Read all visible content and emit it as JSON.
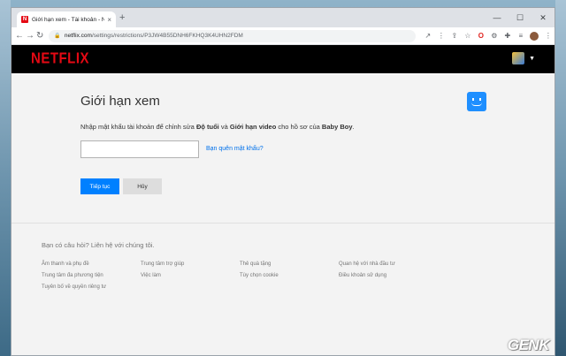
{
  "browser": {
    "tab_title": "Giới hạn xem - Tài khoản - Netflix",
    "tab_close": "×",
    "new_tab": "+",
    "window_controls": {
      "minimize": "—",
      "maximize": "☐",
      "close": "✕"
    },
    "nav": {
      "back": "←",
      "forward": "→",
      "reload": "↻"
    },
    "url_host": "netflix.com",
    "url_path": "/settings/restrictions/P3JW4B55DNH6FKHQ3K4UHN2FDM",
    "toolbar_icons": [
      "↗",
      "⋮",
      "⇪",
      "☆"
    ],
    "menu": "⋮"
  },
  "netflix": {
    "logo": "NETFLIX",
    "profile_caret": "▼"
  },
  "main": {
    "title": "Giới hạn xem",
    "desc_prefix": "Nhập mật khẩu tài khoản để chỉnh sửa ",
    "desc_b1": "Độ tuổi",
    "desc_mid": " và ",
    "desc_b2": "Giới hạn video",
    "desc_mid2": " cho hồ sơ của ",
    "desc_b3": "Baby Boy",
    "desc_suffix": ".",
    "password_value": "",
    "forgot_password": "Bạn quên mật khẩu?",
    "continue_label": "Tiếp tục",
    "cancel_label": "Hủy"
  },
  "footer": {
    "question": "Bạn có câu hỏi? Liên hệ với chúng tôi.",
    "links": [
      "Âm thanh và phụ đề",
      "Trung tâm trợ giúp",
      "Thẻ quà tặng",
      "Quan hệ với nhà đầu tư",
      "Trung tâm đa phương tiện",
      "Việc làm",
      "Tùy chọn cookie",
      "Điều khoản sử dụng",
      "Tuyên bố về quyền riêng tư"
    ]
  },
  "watermark": {
    "text": "GENK"
  },
  "colors": {
    "netflix_red": "#e50914",
    "button_blue": "#0080ff",
    "link_blue": "#0071eb",
    "kids_blue": "#1f8fff"
  }
}
